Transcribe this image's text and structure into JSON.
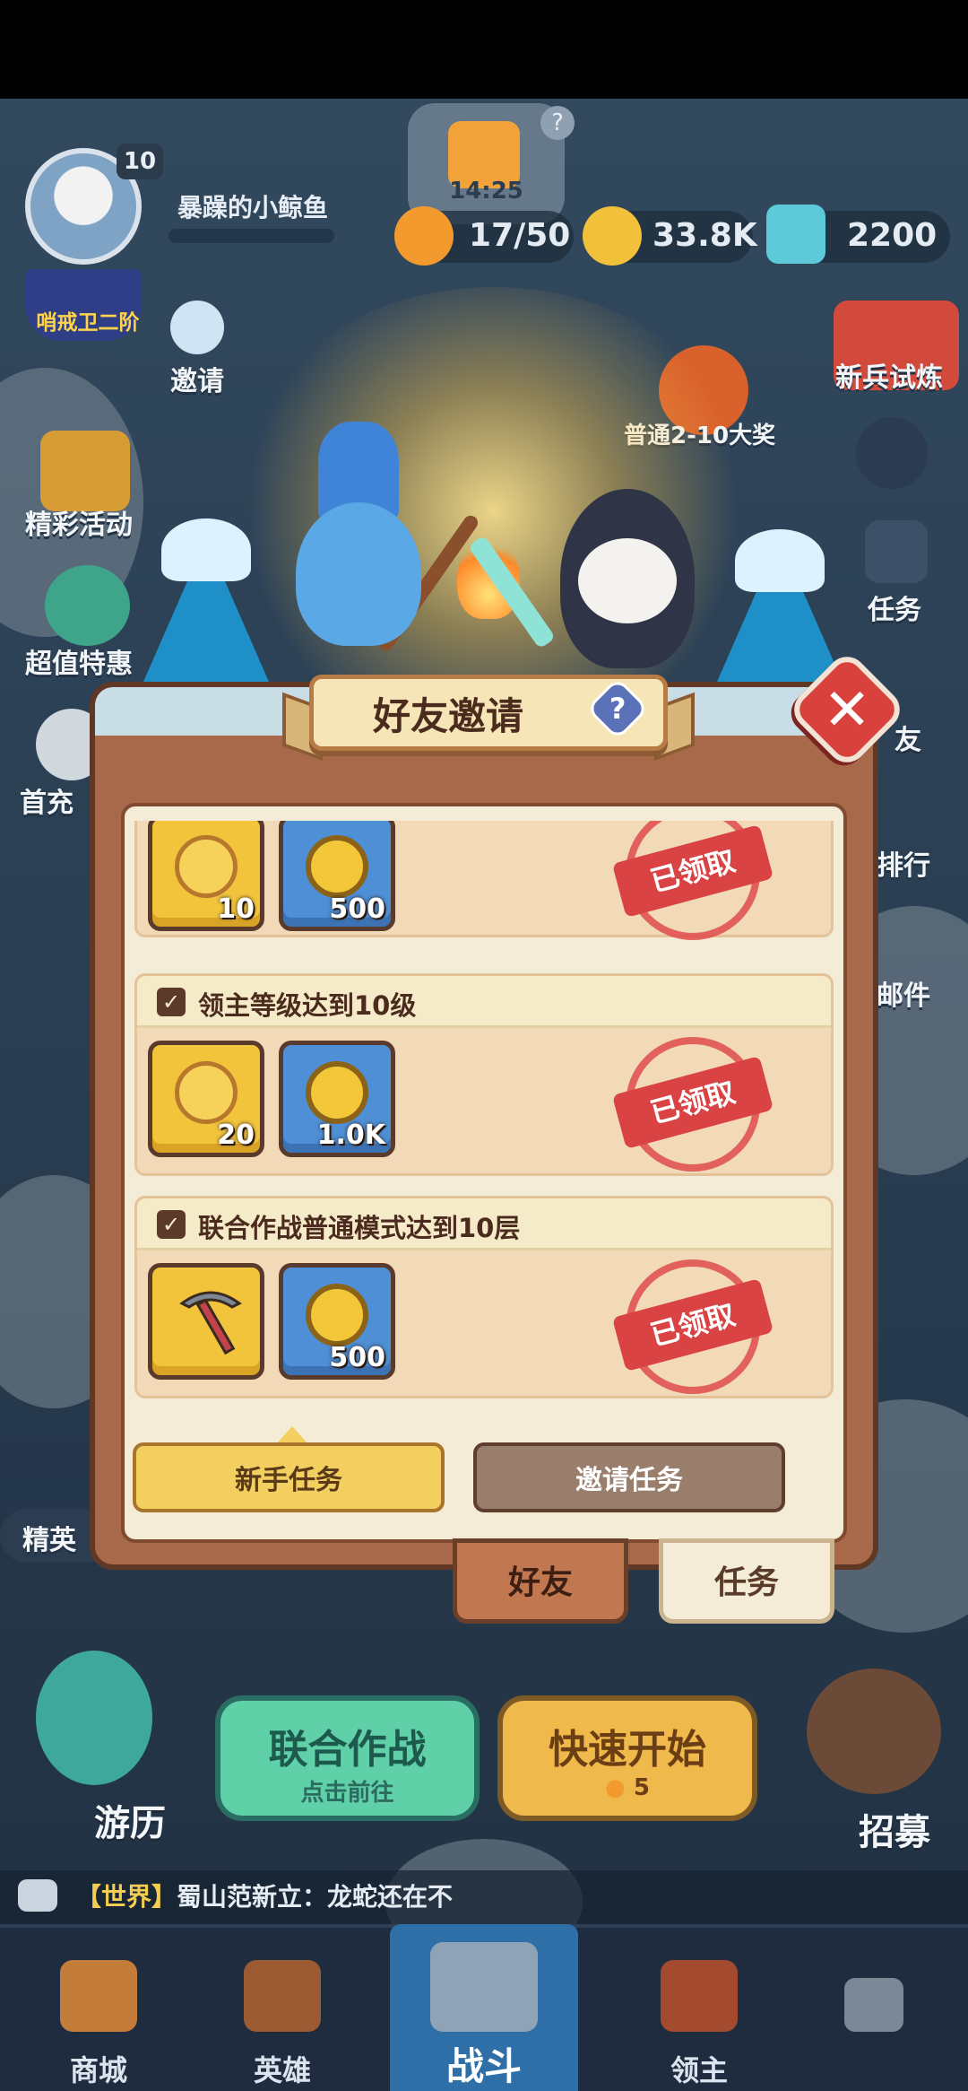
{
  "hud": {
    "level": "10",
    "player_name": "暴躁的小鲸鱼",
    "rank": "哨戒卫二阶",
    "timer": "14:25",
    "stamina": "17/50",
    "gold": "33.8K",
    "gems": "2200"
  },
  "side_left": {
    "invite": "邀请",
    "events": "精彩活动",
    "deals": "超值特惠",
    "first_charge": "首充",
    "elite": "精英"
  },
  "side_right": {
    "trial": "新兵试炼",
    "bonus": "普通2-10大奖",
    "tasks": "任务",
    "friends": "友",
    "ranking": "排行",
    "mail": "邮件"
  },
  "popup": {
    "title": "好友邀请",
    "help": "?",
    "close": "✕",
    "tasks": [
      {
        "title": "",
        "rewards": [
          {
            "type": "key",
            "amount": "10"
          },
          {
            "type": "coin",
            "amount": "500"
          }
        ],
        "status": "已领取"
      },
      {
        "title": "领主等级达到10级",
        "rewards": [
          {
            "type": "key",
            "amount": "20"
          },
          {
            "type": "coin",
            "amount": "1.0K"
          }
        ],
        "status": "已领取"
      },
      {
        "title": "联合作战普通模式达到10层",
        "rewards": [
          {
            "type": "pickaxe",
            "amount": ""
          },
          {
            "type": "coin",
            "amount": "500"
          }
        ],
        "status": "已领取"
      }
    ],
    "subtabs": {
      "newbie": "新手任务",
      "invite": "邀请任务"
    },
    "tabs": {
      "friends": "好友",
      "tasks": "任务"
    }
  },
  "scene": {
    "coop_title": "联合作战",
    "coop_sub": "点击前往",
    "quick_title": "快速开始",
    "quick_cost": "5",
    "travel": "游历",
    "recruit": "招募"
  },
  "chat": {
    "channel": "【世界】",
    "message": "蜀山范新立：龙蛇还在不"
  },
  "nav": {
    "shop": "商城",
    "heroes": "英雄",
    "battle": "战斗",
    "lord": "领主"
  },
  "colors": {
    "accent_gold": "#f3cf5f",
    "panel_brown": "#a8694a",
    "stamp_red": "#d94343",
    "close_red": "#d8413c"
  }
}
